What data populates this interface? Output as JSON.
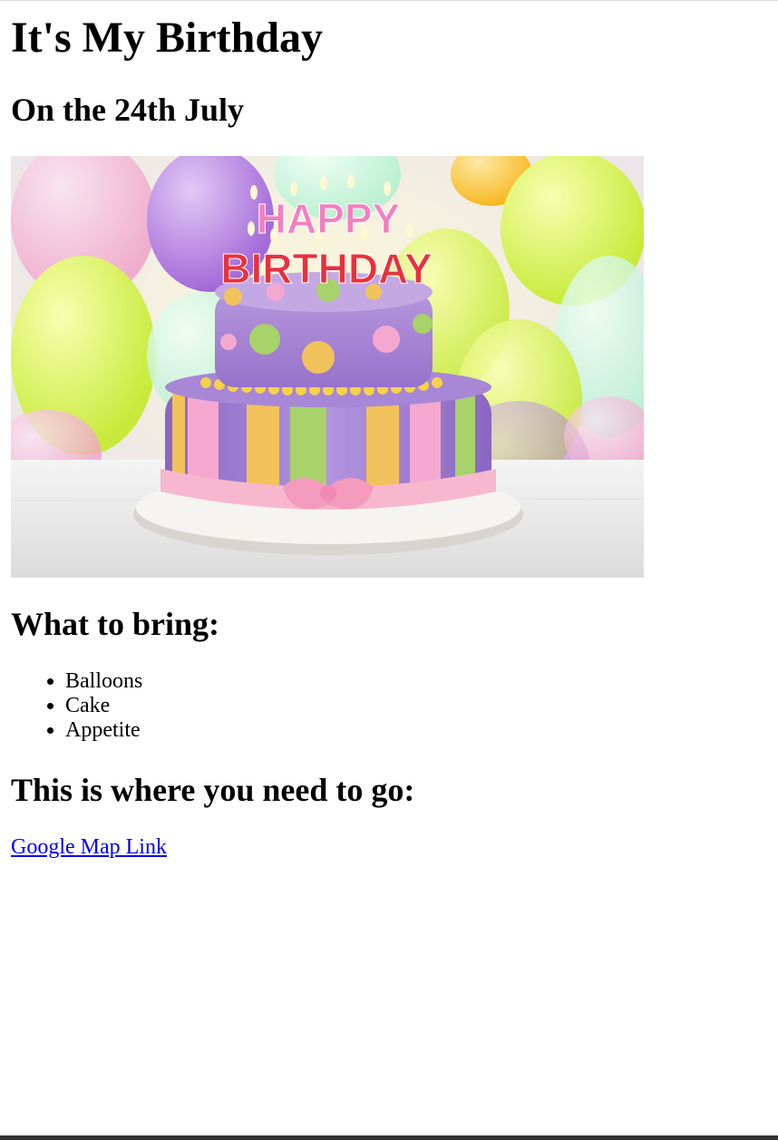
{
  "page": {
    "title": "It's My Birthday",
    "subtitle": "On the 24th July"
  },
  "image": {
    "description": "birthday-cake-photo",
    "banner_line1": "HAPPY",
    "banner_line2": "BIRTHDAY"
  },
  "bring": {
    "heading": "What to bring:",
    "items": [
      "Balloons",
      "Cake",
      "Appetite"
    ]
  },
  "location": {
    "heading": "This is where you need to go:",
    "link_label": "Google Map Link"
  },
  "colors": {
    "link": "#0000ee",
    "text": "#000000",
    "background": "#ffffff"
  }
}
